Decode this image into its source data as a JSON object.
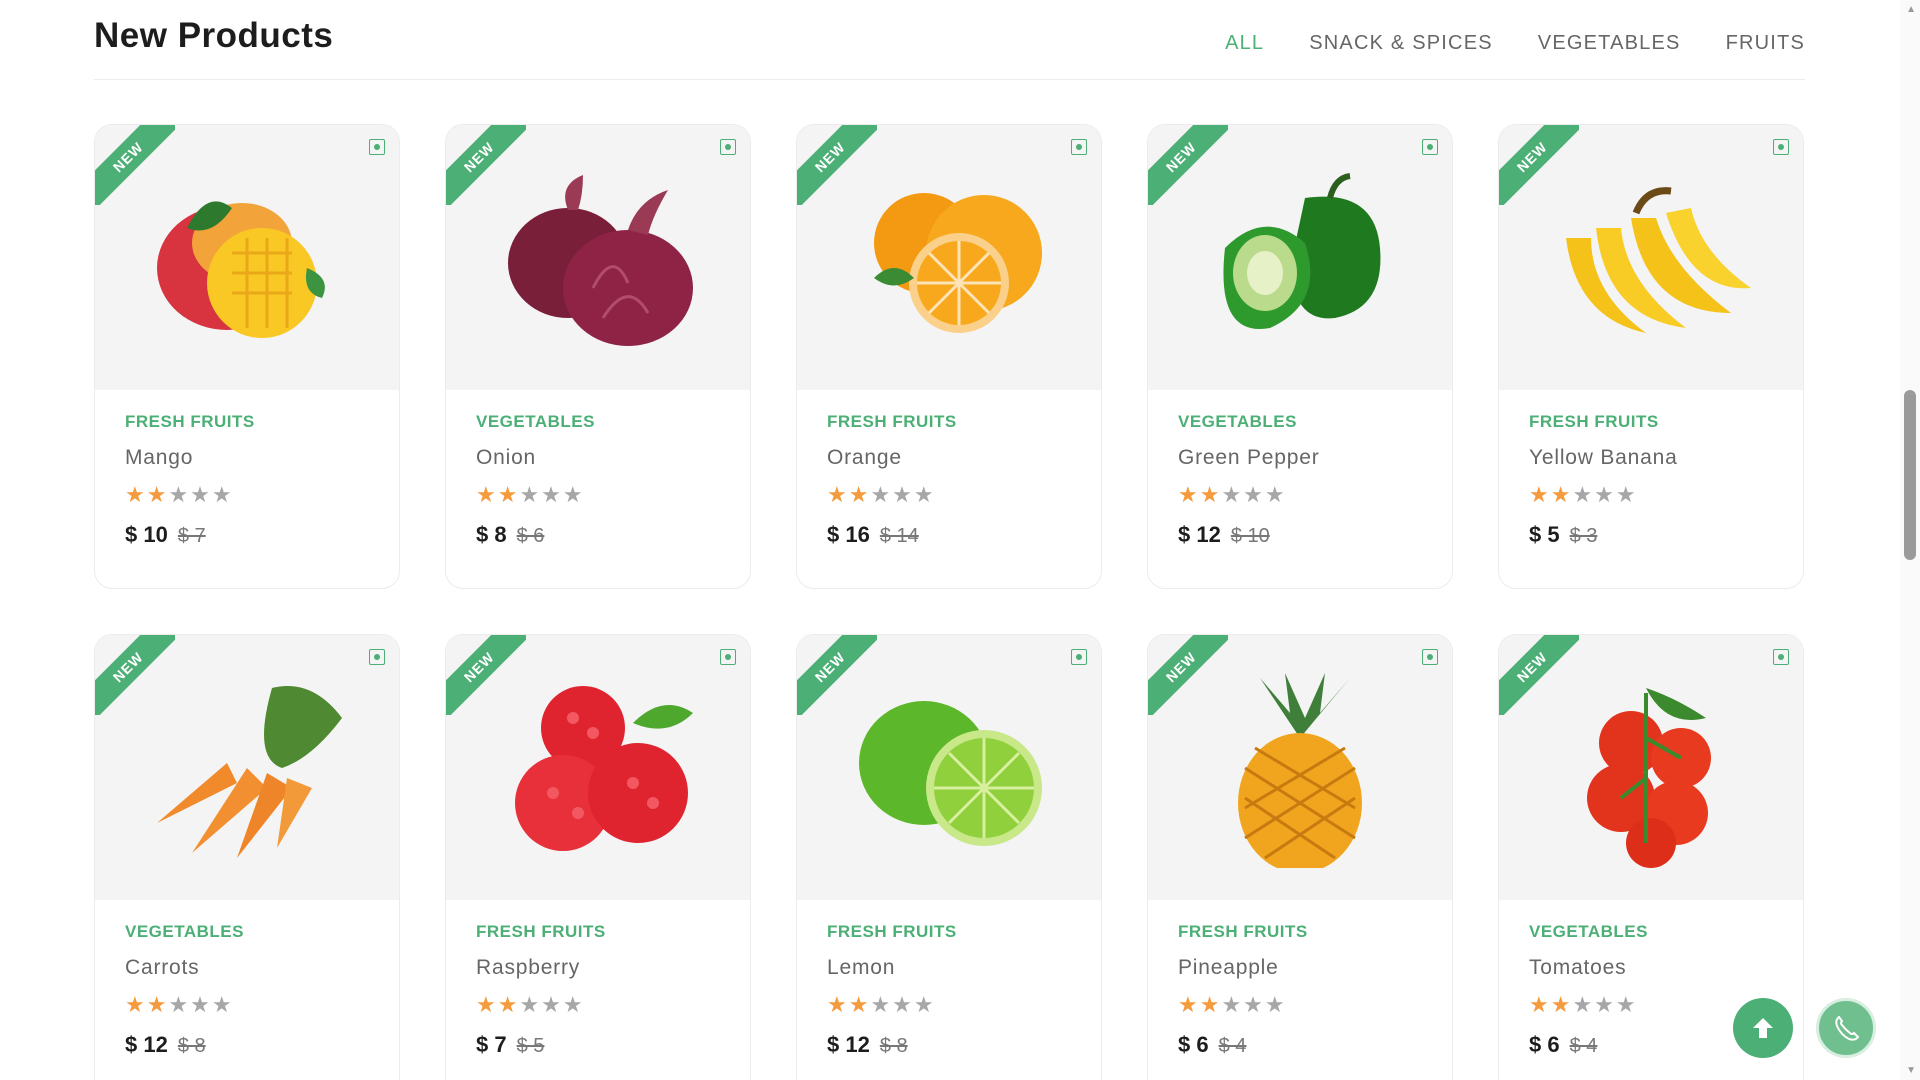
{
  "section": {
    "title": "New Products",
    "tabs": [
      {
        "label": "ALL",
        "active": true
      },
      {
        "label": "SNACK & SPICES",
        "active": false
      },
      {
        "label": "VEGETABLES",
        "active": false
      },
      {
        "label": "FRUITS",
        "active": false
      }
    ]
  },
  "badge_label": "NEW",
  "accent_color": "#4caf76",
  "products": [
    {
      "category": "FRESH FRUITS",
      "name": "Mango",
      "price": "$ 10",
      "old_price": "$ 7",
      "rating": 2,
      "image": "mango-image"
    },
    {
      "category": "VEGETABLES",
      "name": "Onion",
      "price": "$ 8",
      "old_price": "$ 6",
      "rating": 2,
      "image": "onion-image"
    },
    {
      "category": "FRESH FRUITS",
      "name": "Orange",
      "price": "$ 16",
      "old_price": "$ 14",
      "rating": 2,
      "image": "orange-image"
    },
    {
      "category": "VEGETABLES",
      "name": "Green Pepper",
      "price": "$ 12",
      "old_price": "$ 10",
      "rating": 2,
      "image": "pepper-image"
    },
    {
      "category": "FRESH FRUITS",
      "name": "Yellow Banana",
      "price": "$ 5",
      "old_price": "$ 3",
      "rating": 2,
      "image": "banana-image"
    },
    {
      "category": "VEGETABLES",
      "name": "Carrots",
      "price": "$ 12",
      "old_price": "$ 8",
      "rating": 2,
      "image": "carrot-image"
    },
    {
      "category": "FRESH FRUITS",
      "name": "Raspberry",
      "price": "$ 7",
      "old_price": "$ 5",
      "rating": 2,
      "image": "raspberry-image"
    },
    {
      "category": "FRESH FRUITS",
      "name": "Lemon",
      "price": "$ 12",
      "old_price": "$ 8",
      "rating": 2,
      "image": "lemon-image"
    },
    {
      "category": "FRESH FRUITS",
      "name": "Pineapple",
      "price": "$ 6",
      "old_price": "$ 4",
      "rating": 2,
      "image": "pineapple-image"
    },
    {
      "category": "VEGETABLES",
      "name": "Tomatoes",
      "price": "$ 6",
      "old_price": "$ 4",
      "rating": 2,
      "image": "tomato-image"
    }
  ]
}
